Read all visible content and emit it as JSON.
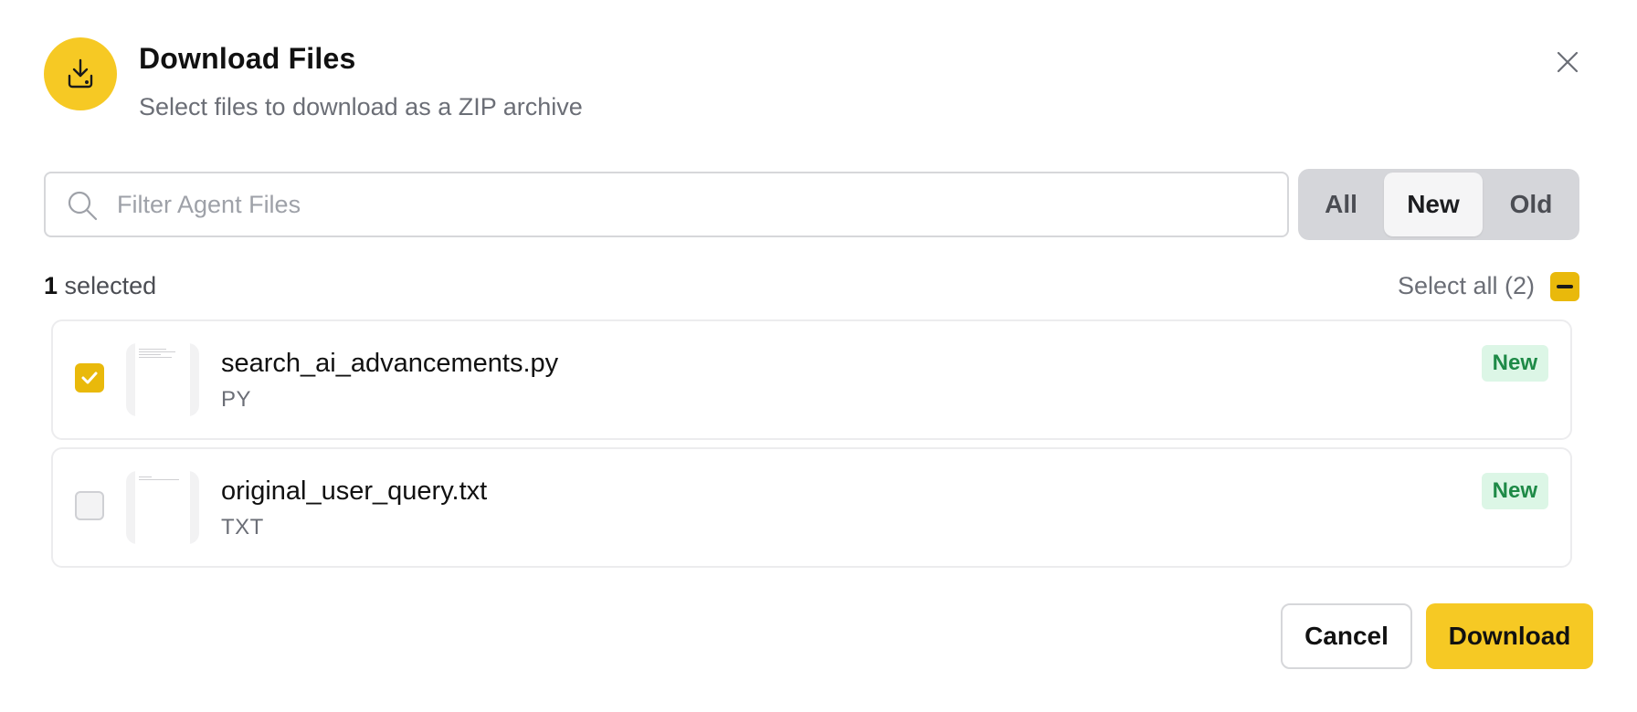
{
  "dialog": {
    "title": "Download Files",
    "subtitle": "Select files to download as a ZIP archive",
    "header_icon": "download-icon",
    "close_icon": "close-icon"
  },
  "search": {
    "placeholder": "Filter Agent Files",
    "value": "",
    "icon": "search-icon"
  },
  "filter_tabs": [
    {
      "label": "All",
      "active": false
    },
    {
      "label": "New",
      "active": true
    },
    {
      "label": "Old",
      "active": false
    }
  ],
  "selection": {
    "count": "1",
    "count_suffix": "selected",
    "select_all_label": "Select all (2)",
    "select_all_state": "indeterminate"
  },
  "files": [
    {
      "name": "search_ai_advancements.py",
      "type": "PY",
      "badge": "New",
      "checked": true
    },
    {
      "name": "original_user_query.txt",
      "type": "TXT",
      "badge": "New",
      "checked": false
    }
  ],
  "footer": {
    "cancel_label": "Cancel",
    "download_label": "Download"
  },
  "colors": {
    "accent": "#f6c924",
    "checkbox_accent": "#e9b90b",
    "badge_bg": "#dcf6e6",
    "badge_text": "#1e8a47"
  }
}
